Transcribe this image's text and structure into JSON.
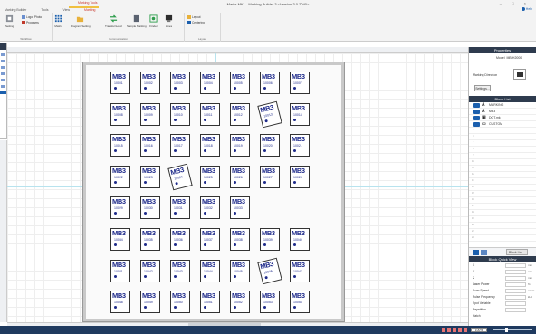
{
  "window": {
    "title": "Marks.MK1 - Marking Builder 3 <Version 3.0.2040>",
    "context_tab": "Marking Tools",
    "controls": "– □ ×",
    "help": "Help"
  },
  "tabs": [
    {
      "label": "Marking Builder",
      "active": false
    },
    {
      "label": "Tools",
      "active": false
    },
    {
      "label": "View",
      "active": false
    },
    {
      "label": "Marking",
      "active": true
    }
  ],
  "ribbon": {
    "groups": [
      {
        "label": "Workflow"
      },
      {
        "label": "Communication"
      },
      {
        "label": "Layout"
      }
    ],
    "buttons": {
      "setting": "Setting",
      "logo_photo": "Logo, Photo",
      "programs": "Programs",
      "matrix": "Matrix",
      "program_setting": "Program Setting",
      "transfer": "Transfer/Load",
      "sample_marking": "Sample Marking",
      "finder": "Finder",
      "lines": "Lines",
      "layout": "Layout",
      "centering": "Centering"
    }
  },
  "tile": {
    "label": "MB3",
    "numbers": [
      "10001",
      "10002",
      "10003",
      "10004",
      "10005",
      "10006",
      "10007",
      "10008",
      "10009",
      "10010",
      "10011",
      "10012",
      "10013",
      "10014",
      "10015",
      "10016",
      "10017",
      "10018",
      "10019",
      "10020",
      "10021",
      "10022",
      "10023",
      "10024",
      "10025",
      "10026",
      "10027",
      "10028",
      "10029",
      "10030",
      "10031",
      "10032",
      "10033",
      "10034",
      "10035",
      "10036",
      "10037",
      "10038",
      "10039",
      "10040",
      "10041",
      "10042",
      "10043",
      "10044",
      "10045",
      "10046",
      "10047",
      "10048",
      "10049",
      "10050",
      "10051",
      "10052",
      "10053",
      "10054",
      "10055"
    ]
  },
  "panel": {
    "properties": {
      "title": "Properties",
      "model_label": "Model",
      "model_value": "MB-H2000",
      "direction_label": "Marking Direction",
      "settings_button": "Settings..."
    },
    "block_list": {
      "title": "Block List",
      "items": [
        {
          "icon": "A",
          "name": "MARKING"
        },
        {
          "icon": "A",
          "name": "MB3"
        },
        {
          "icon": "▣",
          "name": "DOT.mk"
        },
        {
          "icon": "▭",
          "name": "CUSTOM"
        }
      ],
      "line_numbers": [
        "1",
        "2",
        "3",
        "4",
        "5",
        "6",
        "7",
        "8",
        "9",
        "10",
        "11",
        "12",
        "13",
        "14",
        "15",
        "16",
        "17",
        "18",
        "19",
        "20",
        "21",
        "22"
      ],
      "more_button": "Block List..."
    },
    "quick_view": {
      "title": "Block Quick View",
      "rows": [
        {
          "label": "X",
          "unit": "mm"
        },
        {
          "label": "Y",
          "unit": "mm"
        },
        {
          "label": "Z",
          "unit": "mm"
        },
        {
          "label": "Laser Power",
          "unit": "%"
        },
        {
          "label": "Scan Speed",
          "unit": "mm/s"
        },
        {
          "label": "Pulse Frequency",
          "unit": "kHz"
        },
        {
          "label": "Spot Variable",
          "unit": ""
        },
        {
          "label": "Repetition",
          "unit": ""
        }
      ],
      "hatch_label": "Hatch"
    }
  },
  "statusbar": {
    "zoom": "100%"
  }
}
